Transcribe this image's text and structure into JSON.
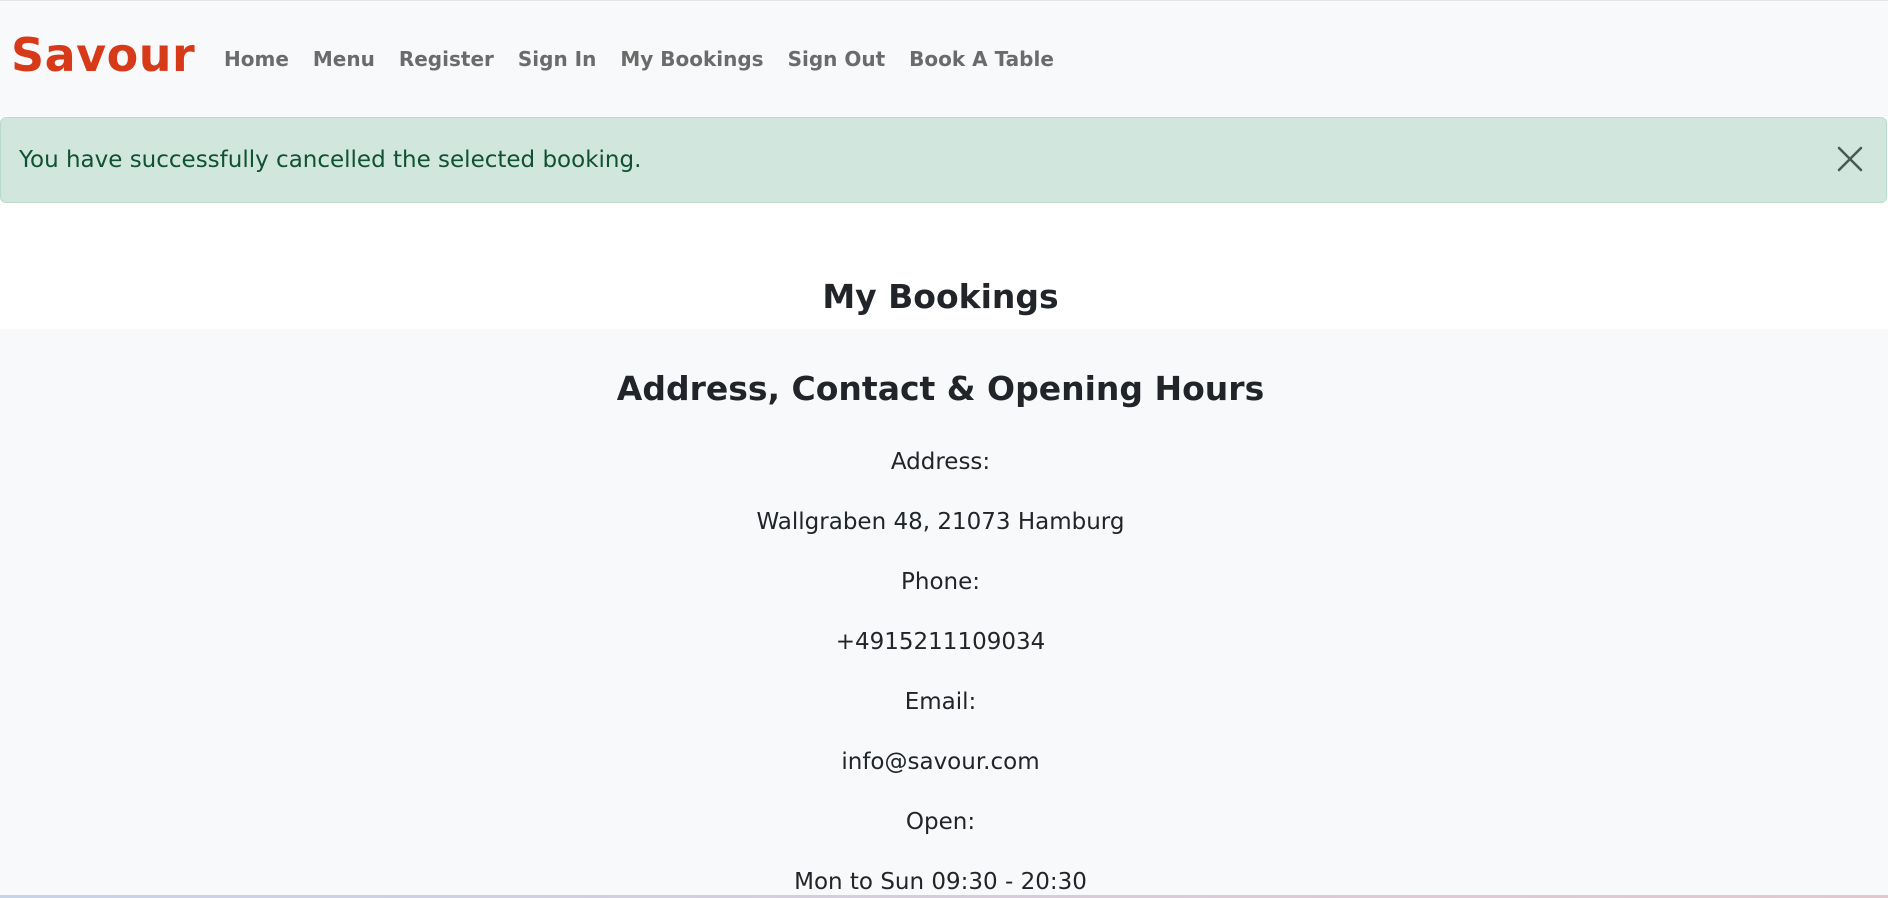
{
  "navbar": {
    "brand": "Savour",
    "links": [
      "Home",
      "Menu",
      "Register",
      "Sign In",
      "My Bookings",
      "Sign Out",
      "Book A Table"
    ]
  },
  "alert": {
    "message": "You have successfully cancelled the selected booking.",
    "close_icon": "close-icon"
  },
  "main": {
    "title": "My Bookings"
  },
  "footer": {
    "title": "Address, Contact & Opening Hours",
    "address_label": "Address:",
    "address_value": "Wallgraben 48, 21073 Hamburg",
    "phone_label": "Phone:",
    "phone_value": "+4915211109034",
    "email_label": "Email:",
    "email_value": "info@savour.com",
    "open_label": "Open:",
    "open_value": "Mon to Sun 09:30 - 20:30"
  },
  "colors": {
    "brand": "#d63a18",
    "alert_bg": "#d1e7dd",
    "alert_text": "#0f5132",
    "nav_link": "#6b6b6b",
    "footer_bg": "#f8f9fa"
  }
}
